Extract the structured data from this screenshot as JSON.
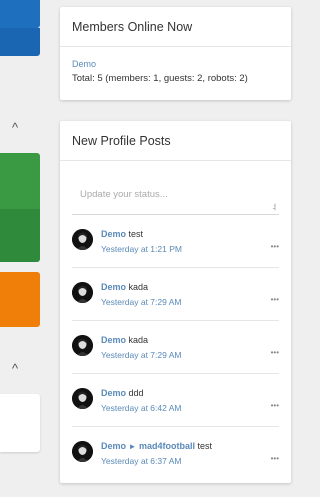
{
  "left_panel": {
    "caret_glyph": "^"
  },
  "members_online": {
    "title": "Members Online Now",
    "user": "Demo",
    "total": "Total: 5 (members: 1, guests: 2, robots: 2)"
  },
  "profile_posts": {
    "title": "New Profile Posts",
    "status_placeholder": "Update your status...",
    "more_glyph": "•••",
    "posts": [
      {
        "user": "Demo",
        "arrow": "",
        "target": "",
        "text": "test",
        "time": "Yesterday at 1:21 PM"
      },
      {
        "user": "Demo",
        "arrow": "",
        "target": "",
        "text": "kada",
        "time": "Yesterday at 7:29 AM"
      },
      {
        "user": "Demo",
        "arrow": "",
        "target": "",
        "text": "kada",
        "time": "Yesterday at 7:29 AM"
      },
      {
        "user": "Demo",
        "arrow": "",
        "target": "",
        "text": "ddd",
        "time": "Yesterday at 6:42 AM"
      },
      {
        "user": "Demo",
        "arrow": "►",
        "target": "mad4football",
        "text": "test",
        "time": "Yesterday at 6:37 AM"
      }
    ]
  },
  "colors": {
    "accent_link": "#5a8ab8",
    "left_blue": "#1f6fbf",
    "left_green": "#3a9a44",
    "left_orange": "#f07f09"
  }
}
